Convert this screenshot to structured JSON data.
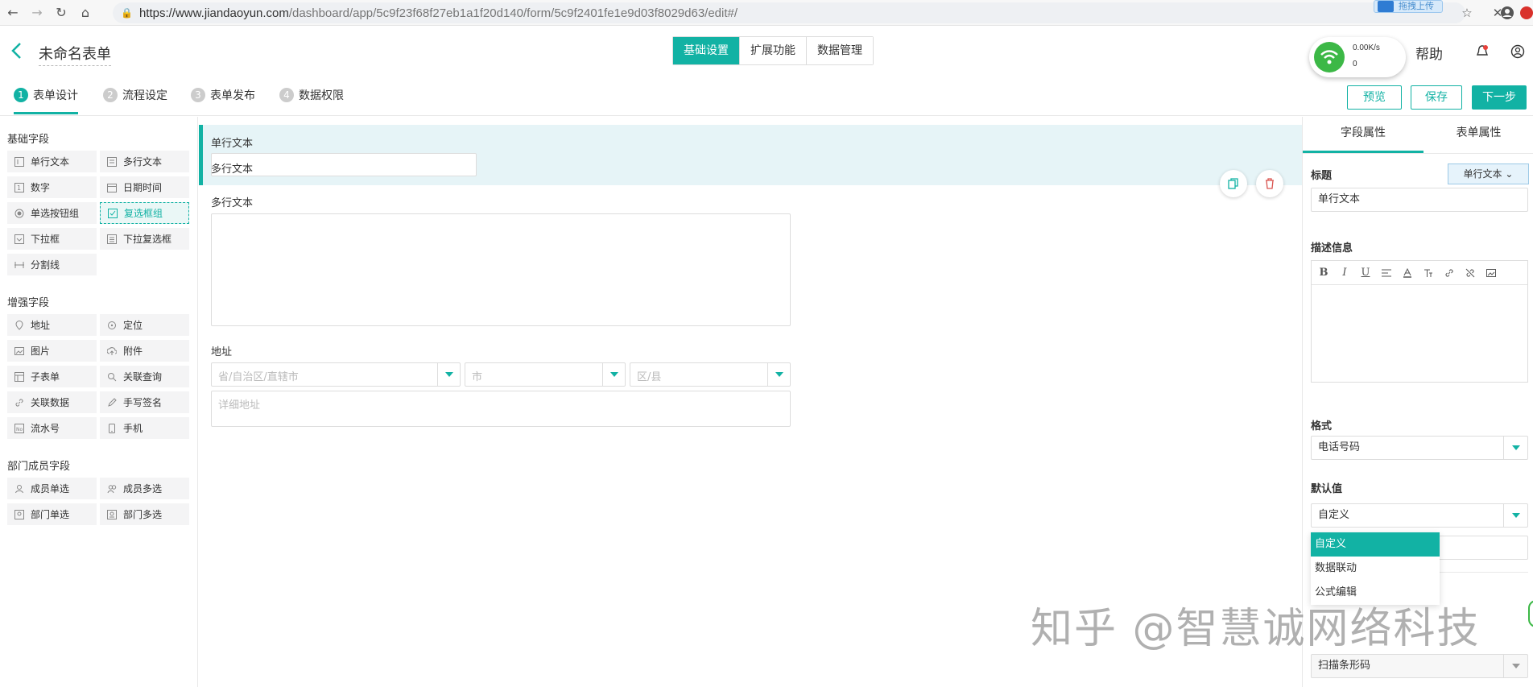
{
  "browser": {
    "url_host": "https://www.jiandaoyun.com",
    "url_path": "/dashboard/app/5c9f23f68f27eb1a1f20d140/form/5c9f2401fe1e9d03f8029d63/edit#/",
    "ext_label": "拖拽上传"
  },
  "header": {
    "form_title": "未命名表单",
    "tabs": [
      "基础设置",
      "扩展功能",
      "数据管理"
    ],
    "help_label": "帮助"
  },
  "net_widget": {
    "speed": "0.00K/s",
    "count": "0"
  },
  "steps": [
    {
      "num": "1",
      "label": "表单设计"
    },
    {
      "num": "2",
      "label": "流程设定"
    },
    {
      "num": "3",
      "label": "表单发布"
    },
    {
      "num": "4",
      "label": "数据权限"
    }
  ],
  "actions": {
    "preview": "预览",
    "save": "保存",
    "next": "下一步"
  },
  "sidebar": {
    "basic_title": "基础字段",
    "basic": [
      "单行文本",
      "多行文本",
      "数字",
      "日期时间",
      "单选按钮组",
      "复选框组",
      "下拉框",
      "下拉复选框",
      "分割线"
    ],
    "enhanced_title": "增强字段",
    "enhanced": [
      "地址",
      "定位",
      "图片",
      "附件",
      "子表单",
      "关联查询",
      "关联数据",
      "手写签名",
      "流水号",
      "手机"
    ],
    "member_title": "部门成员字段",
    "member": [
      "成员单选",
      "成员多选",
      "部门单选",
      "部门多选"
    ]
  },
  "canvas": {
    "field1_label": "单行文本",
    "field2_label": "多行文本",
    "field3_label": "地址",
    "addr_province_ph": "省/自治区/直辖市",
    "addr_city_ph": "市",
    "addr_district_ph": "区/县",
    "addr_detail_ph": "详细地址"
  },
  "right_panel": {
    "tabs": [
      "字段属性",
      "表单属性"
    ],
    "title_label": "标题",
    "type_button": "单行文本",
    "title_value": "单行文本",
    "desc_label": "描述信息",
    "toolbar": [
      "B",
      "I",
      "U"
    ],
    "format_label": "格式",
    "format_value": "电话号码",
    "default_label": "默认值",
    "default_value": "自定义",
    "dropdown": [
      "自定义",
      "数据联动",
      "公式编辑"
    ],
    "scan_value": "扫描条形码"
  },
  "watermark": "知乎 @智慧诚网络科技",
  "colors": {
    "accent": "#12b2a4",
    "selected_bg": "#e6f4f7"
  }
}
